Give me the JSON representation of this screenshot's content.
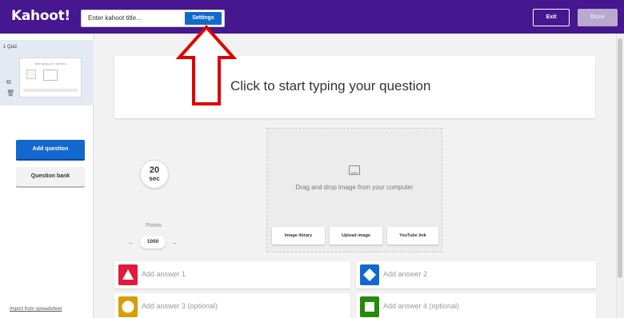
{
  "topbar": {
    "logo": "Kahoot!",
    "title_placeholder": "Enter kahoot title...",
    "settings_label": "Settings",
    "exit_label": "Exit",
    "done_label": "Done",
    "bg_color": "#46178f"
  },
  "sidebar": {
    "slide_label": "1 Quiz",
    "thumb_text": "Start typing your question",
    "add_question_label": "Add question",
    "question_bank_label": "Question bank",
    "import_label": "Import from spreadsheet"
  },
  "editor": {
    "question_placeholder": "Click to start typing your question",
    "timer_value": "20",
    "timer_unit": "sec",
    "points_label": "Points",
    "points_value": "1000",
    "media_text": "Drag and drop image from your computer",
    "media_buttons": [
      "Image library",
      "Upload image",
      "YouTube link"
    ]
  },
  "answers": [
    {
      "label": "Add answer 1",
      "color": "#e21b3c",
      "shape": "triangle-icon"
    },
    {
      "label": "Add answer 2",
      "color": "#1368ce",
      "shape": "diamond-icon"
    },
    {
      "label": "Add answer 3 (optional)",
      "color": "#d89e00",
      "shape": "circle-icon"
    },
    {
      "label": "Add answer 4 (optional)",
      "color": "#26890c",
      "shape": "square-icon"
    }
  ]
}
